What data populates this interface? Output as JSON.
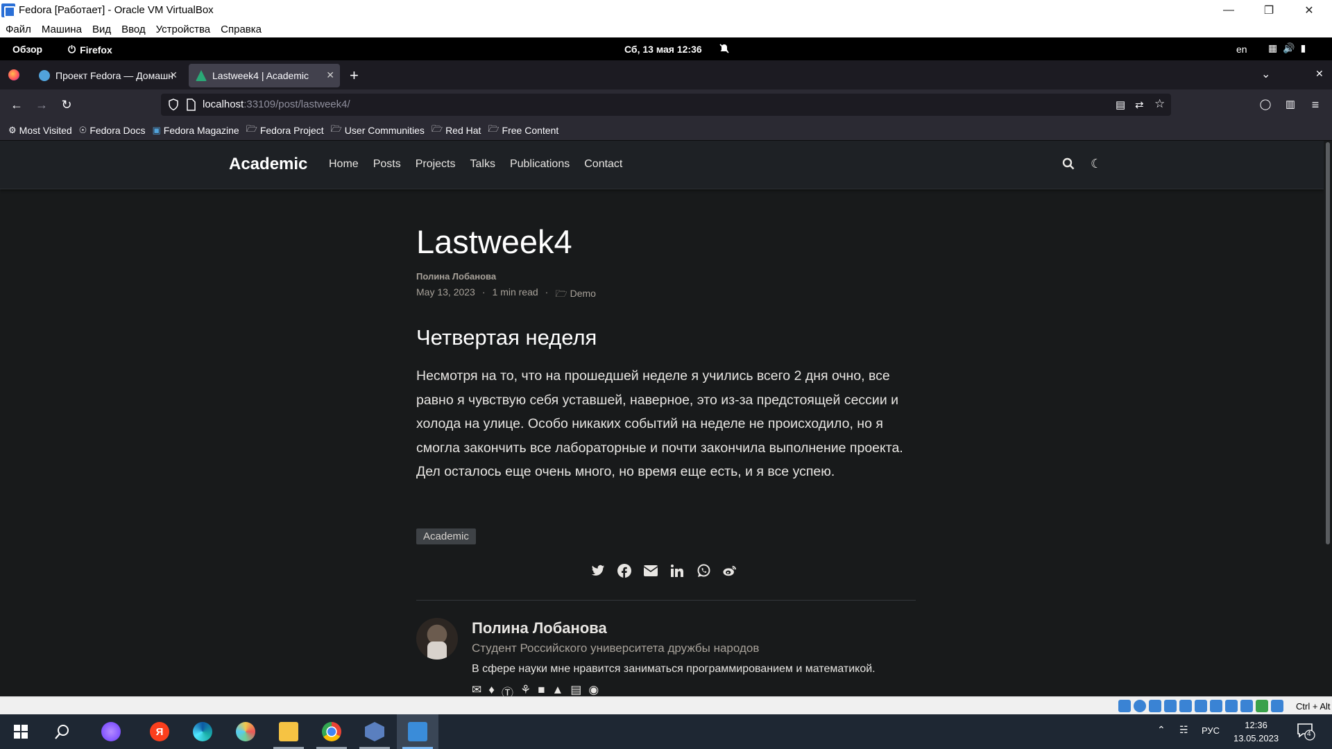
{
  "vbox": {
    "title": "Fedora [Работает] - Oracle VM VirtualBox",
    "menu": [
      "Файл",
      "Машина",
      "Вид",
      "Ввод",
      "Устройства",
      "Справка"
    ],
    "hotkey": "Ctrl + Alt"
  },
  "gnome": {
    "overview": "Обзор",
    "app": "Firefox",
    "clock": "Сб, 13 мая  12:36",
    "lang": "en"
  },
  "firefox": {
    "tabs": [
      {
        "title": "Проект Fedora — Домашня",
        "active": false
      },
      {
        "title": "Lastweek4 | Academic",
        "active": true
      }
    ],
    "url_host": "localhost",
    "url_path": ":33109/post/lastweek4/",
    "bookmarks": [
      "Most Visited",
      "Fedora Docs",
      "Fedora Magazine",
      "Fedora Project",
      "User Communities",
      "Red Hat",
      "Free Content"
    ]
  },
  "site": {
    "brand": "Academic",
    "nav": [
      "Home",
      "Posts",
      "Projects",
      "Talks",
      "Publications",
      "Contact"
    ]
  },
  "post": {
    "title": "Lastweek4",
    "author": "Полина Лобанова",
    "date": "May 13, 2023",
    "read_time": "1 min read",
    "category": "Demo",
    "heading": "Четвертая неделя",
    "body": "Несмотря на то, что на прошедшей неделе я учились всего 2 дня очно, все равно я чувствую себя уставшей, наверное, это из-за предстоящей сессии и холода на улице. Особо никаких событий на неделе не происходило, но я смогла закончить все лабораторные и почти закончила выполнение проекта. Дел осталось еще очень много, но время еще есть, и я все успею.",
    "tag": "Academic",
    "share_icons": [
      "twitter-icon",
      "facebook-icon",
      "email-icon",
      "linkedin-icon",
      "whatsapp-icon",
      "weibo-icon"
    ]
  },
  "author_card": {
    "name": "Полина Лобанова",
    "role": "Студент Российского университета дружбы народов",
    "bio": "В сфере науки мне нравится заниматься программированием и математикой."
  },
  "taskbar": {
    "lang": "РУС",
    "time": "12:36",
    "date": "13.05.2023",
    "notifications": "4"
  }
}
